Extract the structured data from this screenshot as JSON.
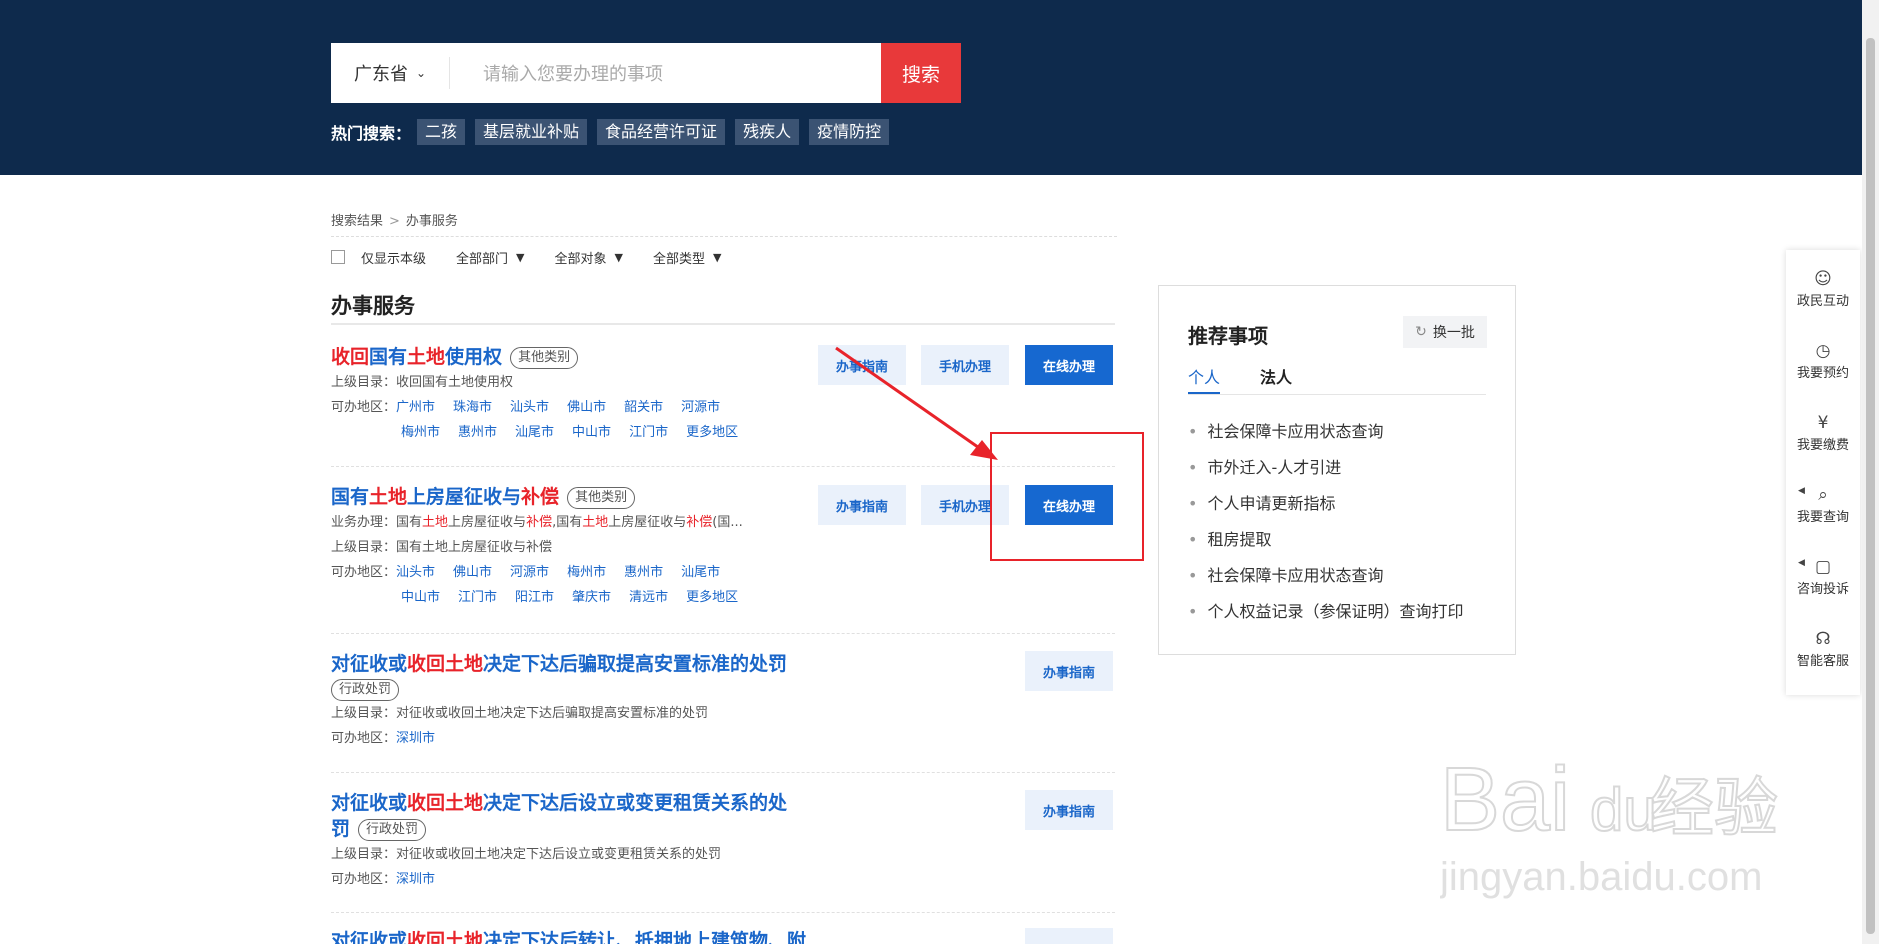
{
  "header": {
    "region": "广东省",
    "search_placeholder": "请输入您要办理的事项",
    "search_button": "搜索",
    "hot_label": "热门搜索：",
    "hot_tags": [
      "二孩",
      "基层就业补贴",
      "食品经营许可证",
      "残疾人",
      "疫情防控"
    ]
  },
  "breadcrumb": {
    "root": "搜索结果",
    "current": "办事服务",
    "sep": ">"
  },
  "filters": {
    "only_this_level": "仅显示本级",
    "dept": "全部部门",
    "target": "全部对象",
    "type": "全部类型"
  },
  "section_title": "办事服务",
  "labels": {
    "parent_dir": "上级目录：",
    "regions": "可办地区：",
    "business": "业务办理："
  },
  "buttons": {
    "guide": "办事指南",
    "mobile": "手机办理",
    "online": "在线办理"
  },
  "results": [
    {
      "title_parts": [
        {
          "t": "收回",
          "hl": true
        },
        {
          "t": "国有",
          "hl": false
        },
        {
          "t": "土地",
          "hl": true
        },
        {
          "t": "使用权",
          "hl": false
        }
      ],
      "tag": "其他类别",
      "parent": "收回国有土地使用权",
      "regions_row1": [
        "广州市",
        "珠海市",
        "汕头市",
        "佛山市",
        "韶关市",
        "河源市"
      ],
      "regions_row2": [
        "梅州市",
        "惠州市",
        "汕尾市",
        "中山市",
        "江门市",
        "更多地区"
      ]
    },
    {
      "title_parts": [
        {
          "t": "国有",
          "hl": false
        },
        {
          "t": "土地",
          "hl": true
        },
        {
          "t": "上房屋征收与",
          "hl": false
        },
        {
          "t": "补偿",
          "hl": true
        }
      ],
      "tag": "其他类别",
      "business_parts": [
        {
          "t": "国有",
          "hl": false
        },
        {
          "t": "土地",
          "hl": true
        },
        {
          "t": "上房屋征收与",
          "hl": false
        },
        {
          "t": "补偿",
          "hl": true
        },
        {
          "t": ",国有",
          "hl": false
        },
        {
          "t": "土地",
          "hl": true
        },
        {
          "t": "上房屋征收与",
          "hl": false
        },
        {
          "t": "补偿",
          "hl": true
        },
        {
          "t": "(国...",
          "hl": false
        }
      ],
      "parent": "国有土地上房屋征收与补偿",
      "regions_row1": [
        "汕头市",
        "佛山市",
        "河源市",
        "梅州市",
        "惠州市",
        "汕尾市"
      ],
      "regions_row2": [
        "中山市",
        "江门市",
        "阳江市",
        "肇庆市",
        "清远市",
        "更多地区"
      ]
    },
    {
      "title_parts": [
        {
          "t": "对征收或",
          "hl": false
        },
        {
          "t": "收回土地",
          "hl": true
        },
        {
          "t": "决定下达后骗取提高安置标准的处罚",
          "hl": false
        }
      ],
      "tag": "行政处罚",
      "parent": "对征收或收回土地决定下达后骗取提高安置标准的处罚",
      "regions_row1": [
        "深圳市"
      ]
    },
    {
      "title_parts": [
        {
          "t": "对征收或",
          "hl": false
        },
        {
          "t": "收回土地",
          "hl": true
        },
        {
          "t": "决定下达后设立或变更租赁关系的处",
          "hl": false
        }
      ],
      "title_line2": "罚",
      "tag": "行政处罚",
      "parent": "对征收或收回土地决定下达后设立或变更租赁关系的处罚",
      "regions_row1": [
        "深圳市"
      ]
    },
    {
      "title_parts": [
        {
          "t": "对征收或",
          "hl": false
        },
        {
          "t": "收回土地",
          "hl": true
        },
        {
          "t": "决定下达后转让、抵押地上建筑物、附",
          "hl": false
        }
      ]
    }
  ],
  "recommend": {
    "title": "推荐事项",
    "refresh": "换一批",
    "tabs": [
      "个人",
      "法人"
    ],
    "items": [
      "社会保障卡应用状态查询",
      "市外迁入-人才引进",
      "个人申请更新指标",
      "租房提取",
      "社会保障卡应用状态查询",
      "个人权益记录（参保证明）查询打印"
    ]
  },
  "sidebar": [
    "政民互动",
    "我要预约",
    "我要缴费",
    "我要查询",
    "咨询投诉",
    "智能客服"
  ],
  "icons": {
    "region_dropdown": "chevron-down-icon",
    "refresh": "refresh-icon",
    "sidebar": [
      "chat-icon",
      "clock-icon",
      "yuan-icon",
      "search-icon",
      "feedback-icon",
      "headset-icon"
    ]
  },
  "colors": {
    "header_bg": "#0e2a4c",
    "accent_red": "#e8393a",
    "link_blue": "#1a66c9",
    "highlight_red": "#e8232a",
    "online_btn": "#1668d0"
  },
  "watermark": {
    "brand": "Bai",
    "brand2": "du",
    "brand3": "经验",
    "url": "jingyan.baidu.com"
  }
}
